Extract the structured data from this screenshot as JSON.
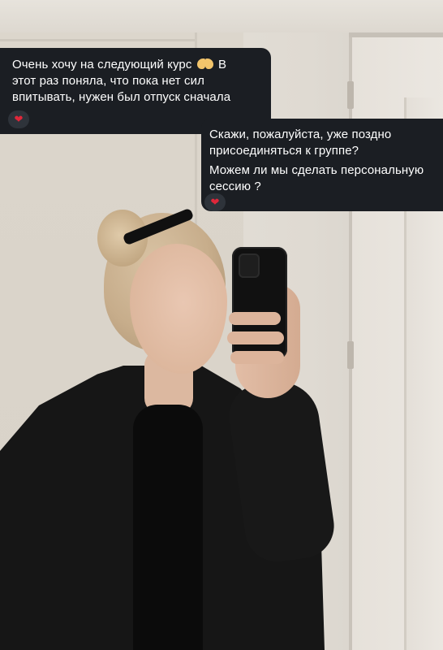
{
  "messages": [
    {
      "lines": [
        "Очень хочу на следующий курс",
        "этот раз поняла, что пока нет сил",
        "впитывать, нужен был отпуск сначала"
      ],
      "line1_suffix": "В",
      "inline_emoji": "heart-hands-emoji",
      "reaction": "❤"
    },
    {
      "lines": [
        "Скажи, пожалуйста, уже поздно",
        "присоединяться к группе?",
        "Можем ли мы сделать персональную",
        "сессию ?"
      ],
      "reaction": "❤"
    }
  ],
  "colors": {
    "bubble_bg": "#1b1e23",
    "bubble_text": "#ffffff",
    "reaction_bg": "#2e333a",
    "heart": "#e0273a"
  }
}
